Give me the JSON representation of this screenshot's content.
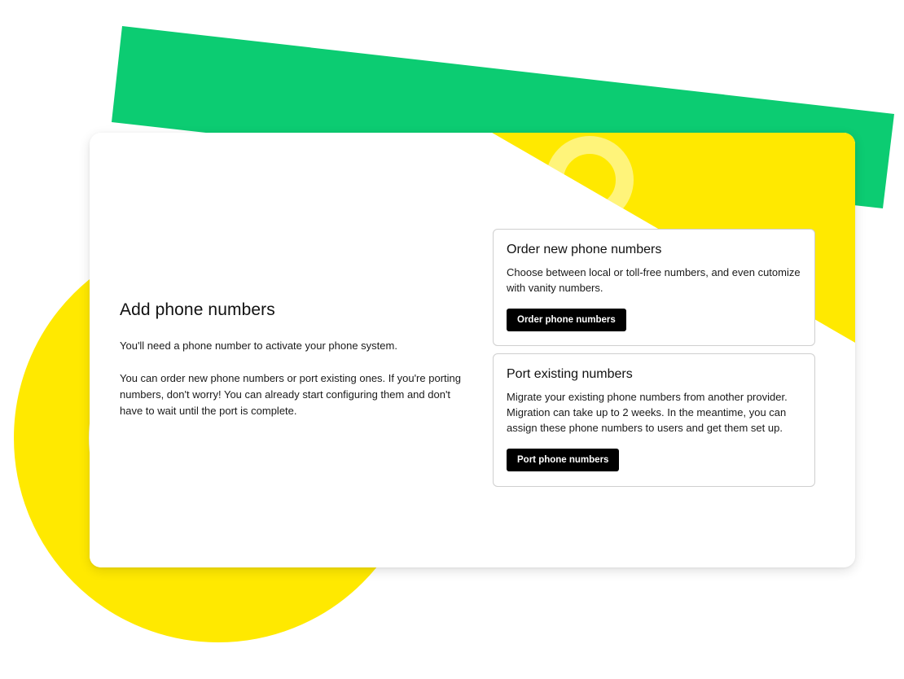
{
  "colors": {
    "accent_green": "#0ccc72",
    "accent_yellow": "#ffe900",
    "button_bg": "#000000",
    "card_border": "#cfcfcf"
  },
  "intro": {
    "title": "Add phone numbers",
    "subtitle": "You'll need a phone number to activate your phone system.",
    "body": "You can order new phone numbers or port existing ones. If you're porting numbers, don't worry! You can already start configuring them and don't have to wait until the port is complete."
  },
  "options": {
    "order": {
      "title": "Order new phone numbers",
      "description": "Choose between local or toll-free numbers, and even cutomize with vanity numbers.",
      "button_label": "Order phone numbers"
    },
    "port": {
      "title": "Port existing numbers",
      "description": "Migrate your existing phone numbers from another provider. Migration can take up to 2 weeks. In the meantime, you can assign these phone numbers to users and get them set up.",
      "button_label": "Port phone numbers"
    }
  }
}
